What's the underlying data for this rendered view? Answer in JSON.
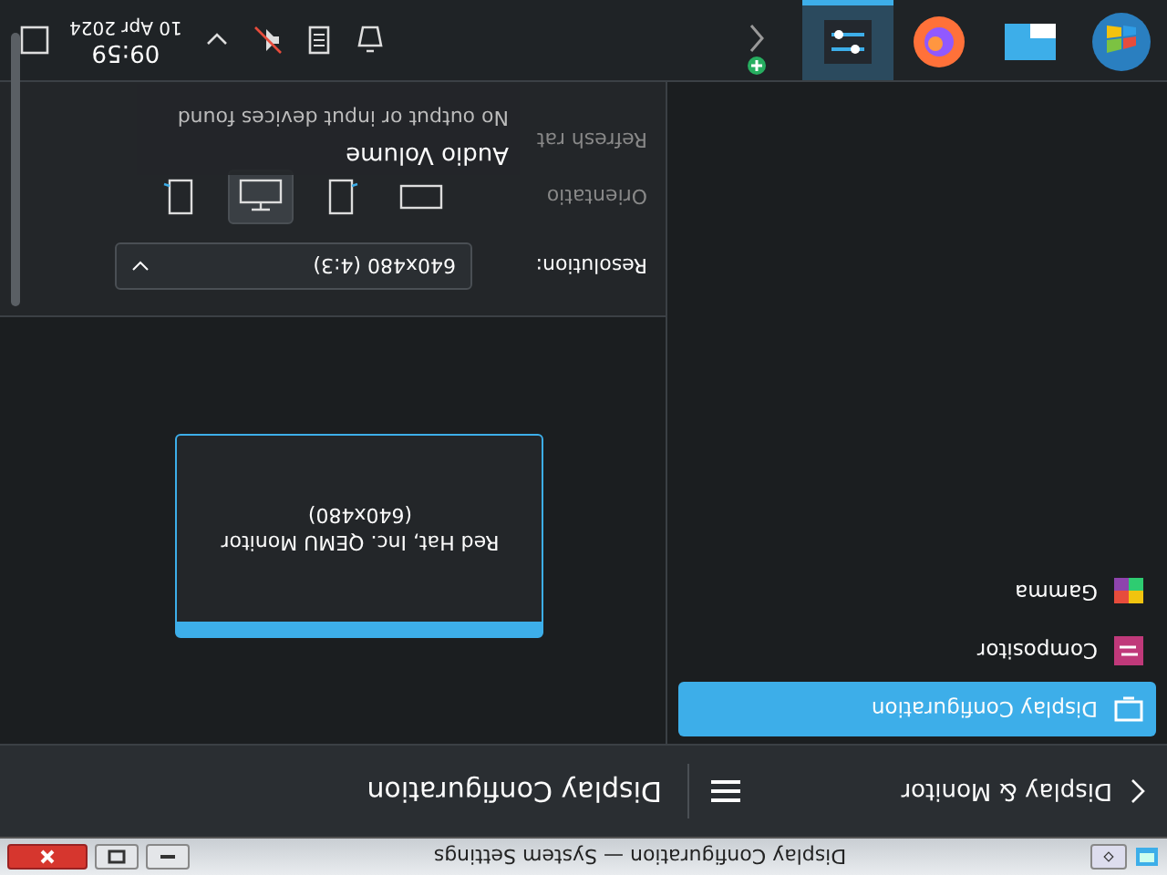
{
  "window": {
    "title": "Display Configuration — System Settings"
  },
  "header": {
    "back_label": "Display & Monitor",
    "page_title": "Display Configuration"
  },
  "sidebar": {
    "items": [
      {
        "label": "Display Configuration",
        "selected": true,
        "kind": "display"
      },
      {
        "label": "Compositor",
        "selected": false,
        "kind": "compositor"
      },
      {
        "label": "Gamma",
        "selected": false,
        "kind": "gamma"
      }
    ]
  },
  "monitor": {
    "name": "Red Hat, Inc. QEMU Monitor",
    "resolution": "(640x480)"
  },
  "settings": {
    "resolution_label": "Resolution:",
    "resolution_value": "640x480 (4:3)",
    "orientation_label": "Orientatio",
    "refresh_label": "Refresh rat",
    "orientations": [
      {
        "kind": "landscape",
        "selected": false
      },
      {
        "kind": "portrait-left",
        "selected": false
      },
      {
        "kind": "flipped",
        "selected": true
      },
      {
        "kind": "portrait-right",
        "selected": false
      }
    ]
  },
  "audio_popup": {
    "title": "Audio Volume",
    "message": "No output or input devices found"
  },
  "taskbar": {
    "apps": [
      {
        "kind": "start",
        "selected": false
      },
      {
        "kind": "files",
        "selected": false
      },
      {
        "kind": "browser",
        "selected": false
      },
      {
        "kind": "settings",
        "selected": true
      },
      {
        "kind": "add",
        "selected": false
      }
    ],
    "clock": {
      "time": "09:59",
      "date": "10 Apr 2024"
    }
  }
}
